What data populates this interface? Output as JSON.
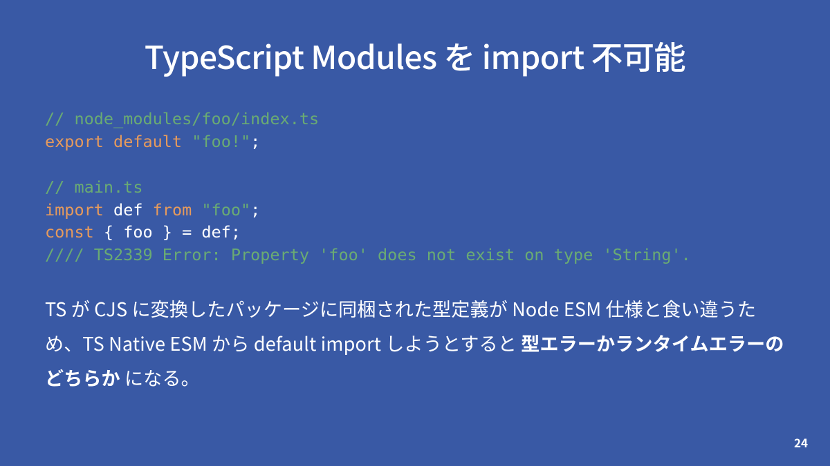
{
  "title": "TypeScript Modules を import 不可能",
  "code": {
    "l1": "// node_modules/foo/index.ts",
    "l2a": "export",
    "l2b": "default",
    "l2c": "\"foo!\"",
    "l2d": ";",
    "l3": "",
    "l4": "// main.ts",
    "l5a": "import",
    "l5b": "def",
    "l5c": "from",
    "l5d": "\"foo\"",
    "l5e": ";",
    "l6a": "const",
    "l6b": "{ foo } = def;",
    "l7": "//// TS2339 Error: Property 'foo' does not exist on type 'String'."
  },
  "body": {
    "p1": "TS が CJS に変換したパッケージに同梱された型定義が Node ESM 仕様と食い違うため、TS Native ESM から default import しようとすると ",
    "p1_bold": "型エラーかランタイムエラーのどちらか",
    "p1_tail": " になる。"
  },
  "page": "24"
}
